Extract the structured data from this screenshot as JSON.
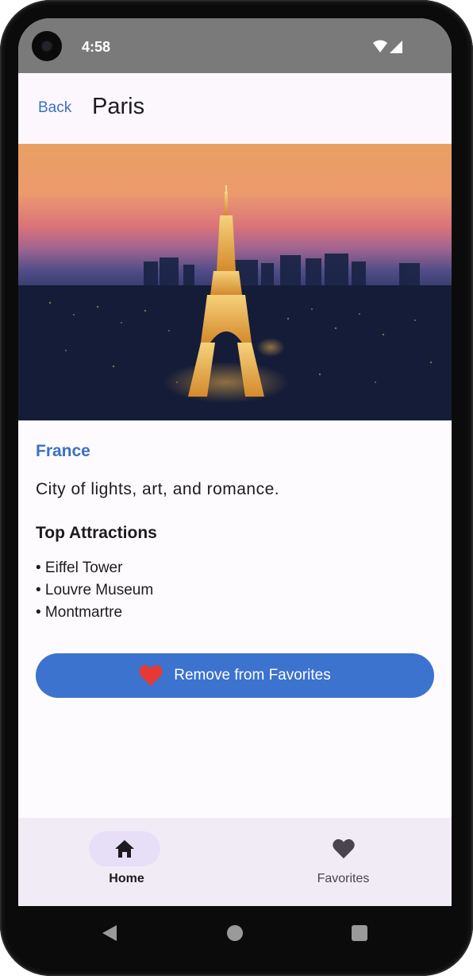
{
  "status_bar": {
    "time": "4:58",
    "icons": [
      "wifi-icon",
      "signal-icon"
    ]
  },
  "app_bar": {
    "back_label": "Back",
    "title": "Paris"
  },
  "hero_image": {
    "subject": "eiffel-tower-at-sunset"
  },
  "details": {
    "country": "France",
    "description": "City of lights, art, and romance.",
    "attractions_title": "Top Attractions",
    "attractions": [
      "• Eiffel Tower",
      "• Louvre Museum",
      "• Montmartre"
    ]
  },
  "favorite_button": {
    "label": "Remove from Favorites",
    "icon": "heart-icon"
  },
  "bottom_nav": {
    "items": [
      {
        "label": "Home",
        "icon": "home-icon",
        "selected": true
      },
      {
        "label": "Favorites",
        "icon": "heart-icon",
        "selected": false
      }
    ]
  },
  "system_nav": {
    "buttons": [
      "back",
      "home",
      "recents"
    ]
  },
  "colors": {
    "accent": "#3b71c4",
    "button": "#3b73ce",
    "heart": "#e53935",
    "nav_background": "#f1ebf6",
    "nav_pill": "#e7def8"
  }
}
